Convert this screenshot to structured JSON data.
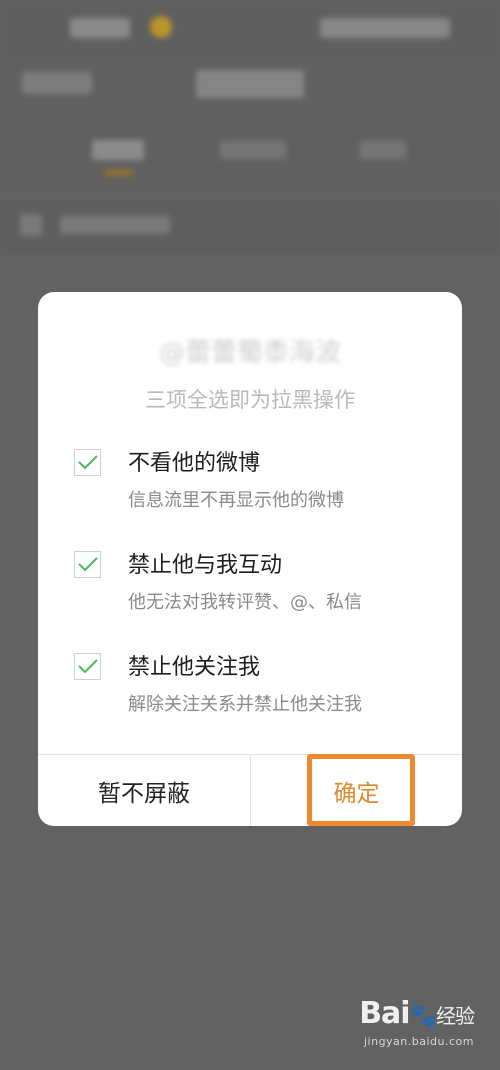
{
  "dialog": {
    "title": "@蕾蕾蜀黍海波",
    "subtitle": "三项全选即为拉黑操作",
    "options": [
      {
        "label": "不看他的微博",
        "description": "信息流里不再显示他的微博",
        "checked": true
      },
      {
        "label": "禁止他与我互动",
        "description": "他无法对我转评赞、@、私信",
        "checked": true
      },
      {
        "label": "禁止他关注我",
        "description": "解除关注关系并禁止他关注我",
        "checked": true
      }
    ],
    "cancel_label": "暂不屏蔽",
    "confirm_label": "确定"
  },
  "watermark": {
    "logo": "Bai",
    "logo_tail": "经验",
    "url": "jingyan.baidu.com"
  },
  "colors": {
    "overlay": "#626262",
    "accent": "#e0892b",
    "highlight": "#f08a2c",
    "check": "#4cb85c"
  }
}
